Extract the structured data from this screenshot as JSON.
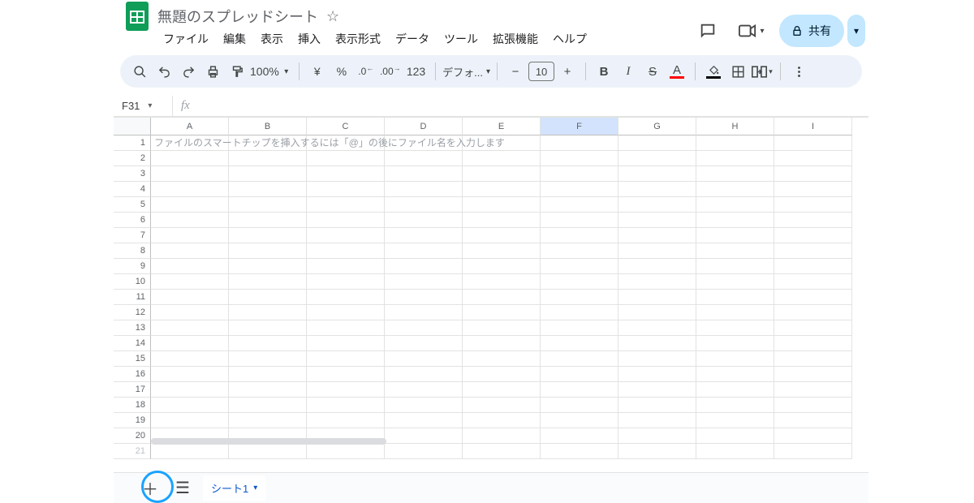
{
  "doc": {
    "title": "無題のスプレッドシート"
  },
  "menus": [
    "ファイル",
    "編集",
    "表示",
    "挿入",
    "表示形式",
    "データ",
    "ツール",
    "拡張機能",
    "ヘルプ"
  ],
  "share": {
    "label": "共有"
  },
  "toolbar": {
    "zoom": "100%",
    "currency": "¥",
    "percent": "%",
    "dec_dec": ".0",
    "dec_inc": ".00",
    "num_123": "123",
    "font_label": "デフォ...",
    "fontsize": "10",
    "bold": "B",
    "italic": "I",
    "textcolor_letter": "A"
  },
  "namebox": {
    "ref": "F31"
  },
  "formula": {
    "fx": "fx"
  },
  "columns": [
    "A",
    "B",
    "C",
    "D",
    "E",
    "F",
    "G",
    "H",
    "I"
  ],
  "selected_col": "F",
  "rows": [
    "1",
    "2",
    "3",
    "4",
    "5",
    "6",
    "7",
    "8",
    "9",
    "10",
    "11",
    "12",
    "13",
    "14",
    "15",
    "16",
    "17",
    "18",
    "19",
    "20",
    "21"
  ],
  "cells": {
    "A1": "ファイルのスマートチップを挿入するには「@」の後にファイル名を入力します"
  },
  "sheet": {
    "active": "シート1"
  }
}
